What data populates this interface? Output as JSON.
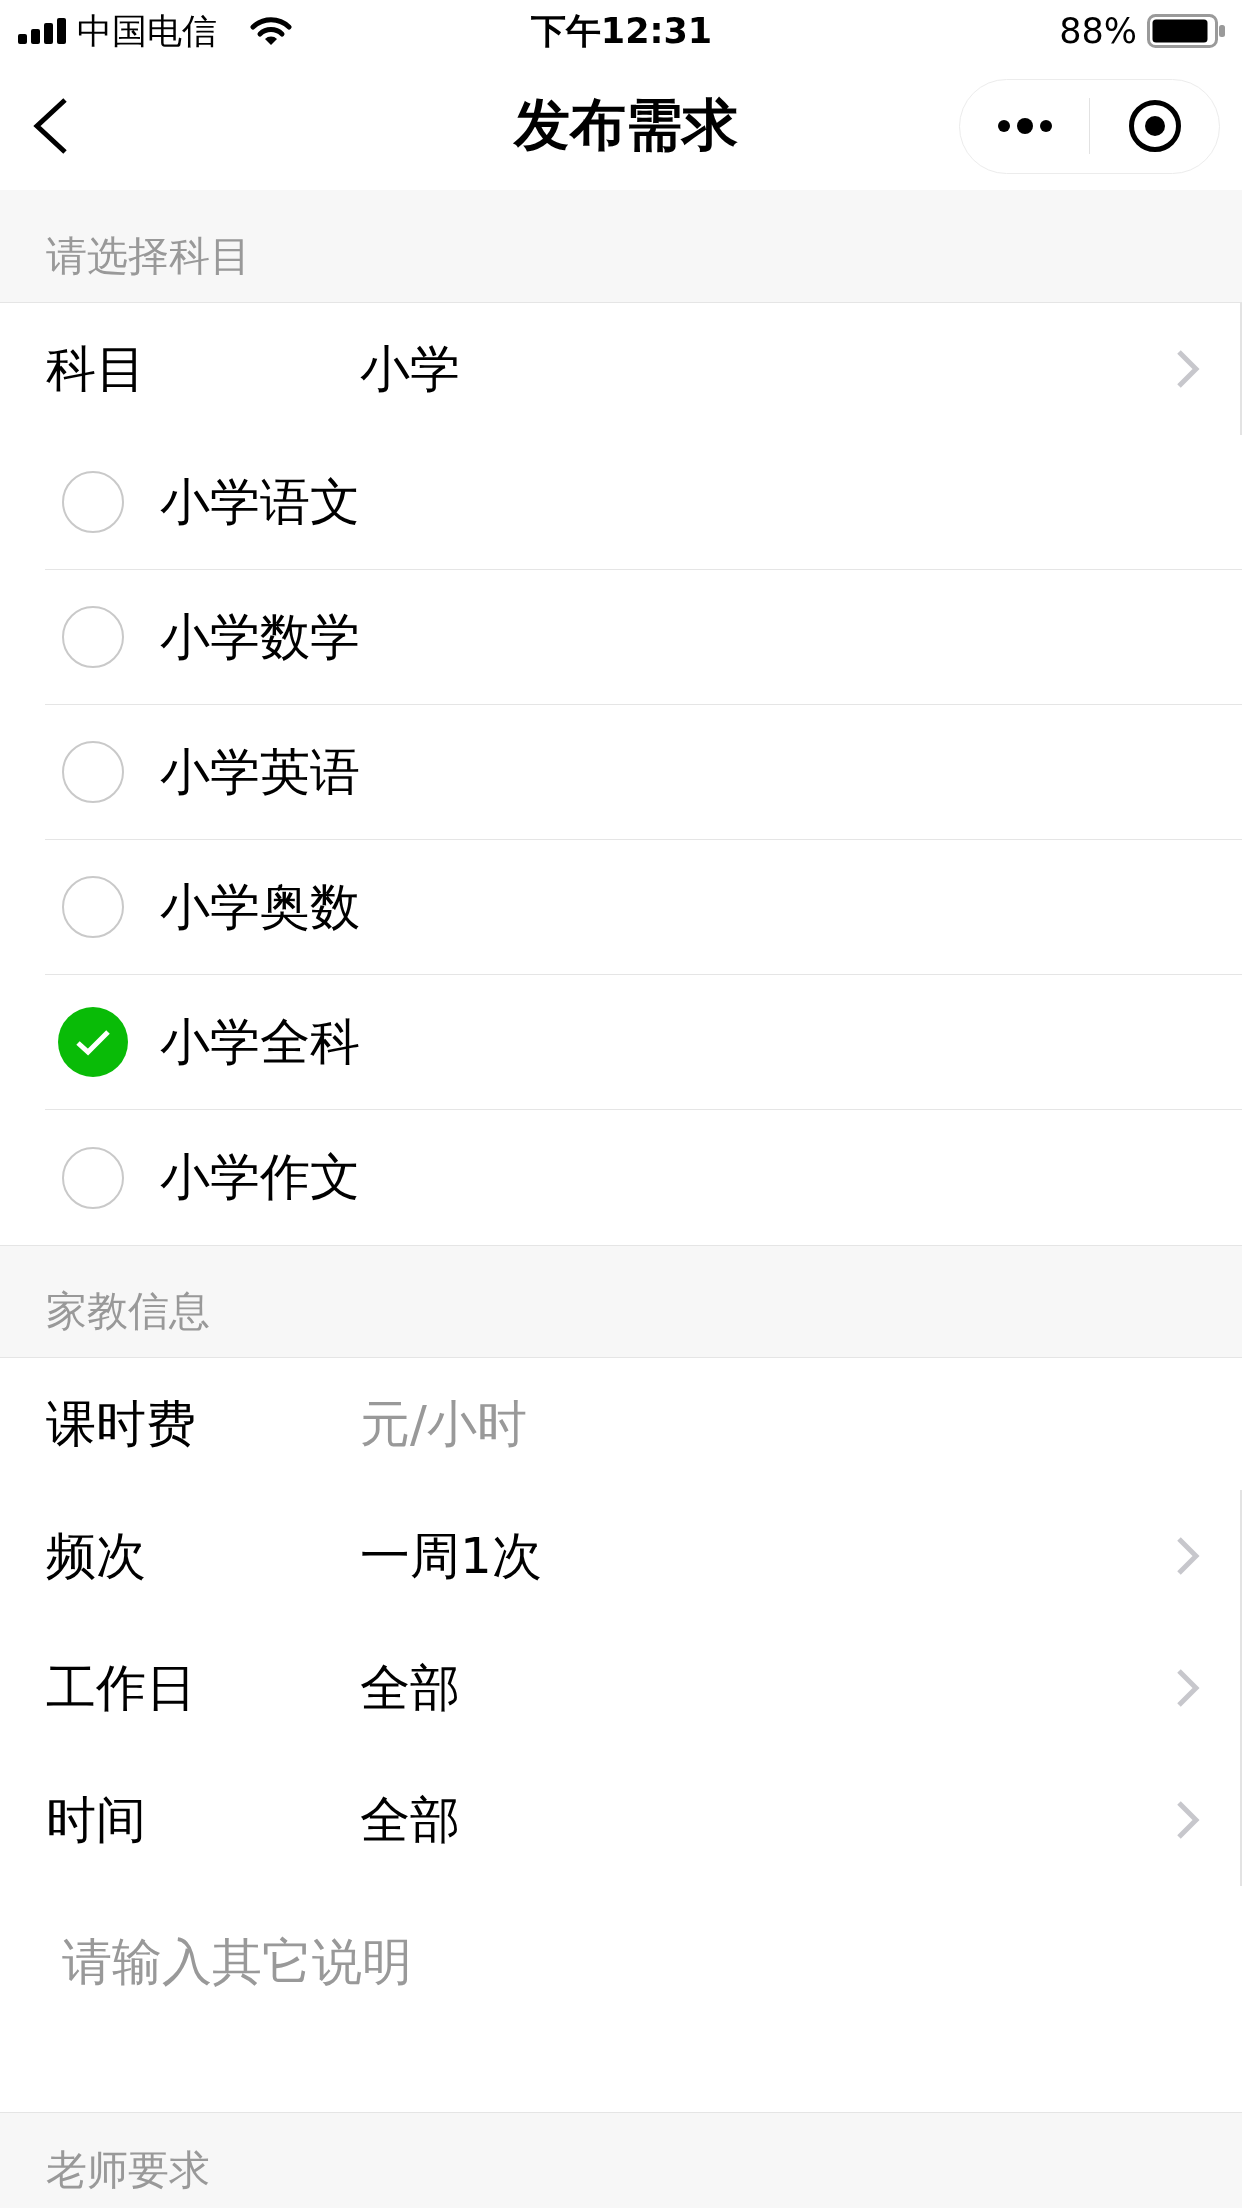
{
  "status_bar": {
    "carrier": "中国电信",
    "time": "下午12:31",
    "battery": "88%"
  },
  "nav_bar": {
    "title": "发布需求"
  },
  "subject_section": {
    "header": "请选择科目",
    "field": {
      "kind": "picker",
      "label": "科目",
      "value": "小学"
    },
    "options": [
      {
        "label": "小学语文",
        "selected": false
      },
      {
        "label": "小学数学",
        "selected": false
      },
      {
        "label": "小学英语",
        "selected": false
      },
      {
        "label": "小学奥数",
        "selected": false
      },
      {
        "label": "小学全科",
        "selected": true
      },
      {
        "label": "小学作文",
        "selected": false
      }
    ]
  },
  "tutor_info_section": {
    "header": "家教信息",
    "rows": [
      {
        "kind": "input",
        "label": "课时费",
        "placeholder": "元/小时"
      },
      {
        "kind": "picker",
        "label": "频次",
        "value": "一周1次"
      },
      {
        "kind": "picker",
        "label": "工作日",
        "value": "全部"
      },
      {
        "kind": "picker",
        "label": "时间",
        "value": "全部"
      }
    ],
    "notes": {
      "placeholder": "请输入其它说明"
    }
  },
  "teacher_section": {
    "header": "老师要求"
  }
}
